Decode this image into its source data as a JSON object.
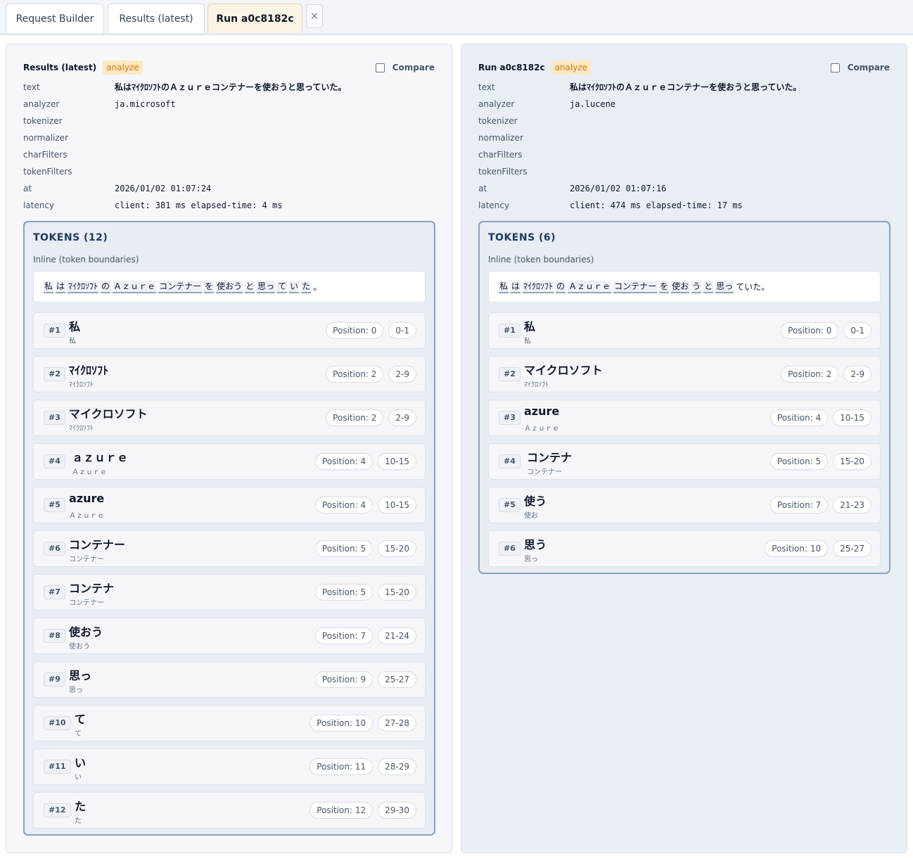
{
  "tabs": [
    {
      "label": "Request Builder"
    },
    {
      "label": "Results (latest)"
    },
    {
      "label": "Run a0c8182c"
    }
  ],
  "tab_close_label": "×",
  "panels": [
    {
      "title": "Results (latest)",
      "badge": "analyze",
      "compare_label": "Compare",
      "meta": [
        {
          "key": "text",
          "value": "私はﾏｲｸﾛｿﾌﾄのＡｚｕｒｅコンテナーを使おうと思っていた。"
        },
        {
          "key": "analyzer",
          "value": "ja.microsoft"
        },
        {
          "key": "tokenizer",
          "value": ""
        },
        {
          "key": "normalizer",
          "value": ""
        },
        {
          "key": "charFilters",
          "value": ""
        },
        {
          "key": "tokenFilters",
          "value": ""
        },
        {
          "key": "at",
          "value": "2026/01/02 01:07:24"
        },
        {
          "key": "latency",
          "value": "client: 381 ms  elapsed-time: 4 ms"
        }
      ],
      "tokens_title": "TOKENS (12)",
      "inline_label": "Inline (token boundaries)",
      "inline_segments": [
        "私",
        "は",
        "ﾏｲｸﾛｿﾌﾄ",
        "の",
        "Ａｚｕｒｅ",
        "コンテナー",
        "を",
        "使おう",
        "と",
        "思っ",
        "て",
        "い",
        "た"
      ],
      "inline_rest": "。",
      "tokens": [
        {
          "index": "#1",
          "term": "私",
          "source": "私",
          "position": "Position: 0",
          "offsets": "0-1"
        },
        {
          "index": "#2",
          "term": "ﾏｲｸﾛｿﾌﾄ",
          "source": "ﾏｲｸﾛｿﾌﾄ",
          "position": "Position: 2",
          "offsets": "2-9"
        },
        {
          "index": "#3",
          "term": "マイクロソフト",
          "source": "ﾏｲｸﾛｿﾌﾄ",
          "position": "Position: 2",
          "offsets": "2-9"
        },
        {
          "index": "#4",
          "term": "ａｚｕｒｅ",
          "source": "Ａｚｕｒｅ",
          "position": "Position: 4",
          "offsets": "10-15"
        },
        {
          "index": "#5",
          "term": "azure",
          "source": "Ａｚｕｒｅ",
          "position": "Position: 4",
          "offsets": "10-15"
        },
        {
          "index": "#6",
          "term": "コンテナー",
          "source": "コンテナー",
          "position": "Position: 5",
          "offsets": "15-20"
        },
        {
          "index": "#7",
          "term": "コンテナ",
          "source": "コンテナー",
          "position": "Position: 5",
          "offsets": "15-20"
        },
        {
          "index": "#8",
          "term": "使おう",
          "source": "使おう",
          "position": "Position: 7",
          "offsets": "21-24"
        },
        {
          "index": "#9",
          "term": "思っ",
          "source": "思っ",
          "position": "Position: 9",
          "offsets": "25-27"
        },
        {
          "index": "#10",
          "term": "て",
          "source": "て",
          "position": "Position: 10",
          "offsets": "27-28"
        },
        {
          "index": "#11",
          "term": "い",
          "source": "い",
          "position": "Position: 11",
          "offsets": "28-29"
        },
        {
          "index": "#12",
          "term": "た",
          "source": "た",
          "position": "Position: 12",
          "offsets": "29-30"
        }
      ]
    },
    {
      "title": "Run a0c8182c",
      "badge": "analyze",
      "compare_label": "Compare",
      "meta": [
        {
          "key": "text",
          "value": "私はﾏｲｸﾛｿﾌﾄのＡｚｕｒｅコンテナーを使おうと思っていた。"
        },
        {
          "key": "analyzer",
          "value": "ja.lucene"
        },
        {
          "key": "tokenizer",
          "value": ""
        },
        {
          "key": "normalizer",
          "value": ""
        },
        {
          "key": "charFilters",
          "value": ""
        },
        {
          "key": "tokenFilters",
          "value": ""
        },
        {
          "key": "at",
          "value": "2026/01/02 01:07:16"
        },
        {
          "key": "latency",
          "value": "client: 474 ms  elapsed-time: 17 ms"
        }
      ],
      "tokens_title": "TOKENS (6)",
      "inline_label": "Inline (token boundaries)",
      "inline_segments": [
        "私",
        "は",
        "ﾏｲｸﾛｿﾌﾄ",
        "の",
        "Ａｚｕｒｅ",
        "コンテナー",
        "を",
        "使お",
        "う",
        "と",
        "思っ"
      ],
      "inline_rest": "ていた。",
      "tokens": [
        {
          "index": "#1",
          "term": "私",
          "source": "私",
          "position": "Position: 0",
          "offsets": "0-1"
        },
        {
          "index": "#2",
          "term": "マイクロソフト",
          "source": "ﾏｲｸﾛｿﾌﾄ",
          "position": "Position: 2",
          "offsets": "2-9"
        },
        {
          "index": "#3",
          "term": "azure",
          "source": "Ａｚｕｒｅ",
          "position": "Position: 4",
          "offsets": "10-15"
        },
        {
          "index": "#4",
          "term": "コンテナ",
          "source": "コンテナー",
          "position": "Position: 5",
          "offsets": "15-20"
        },
        {
          "index": "#5",
          "term": "使う",
          "source": "使お",
          "position": "Position: 7",
          "offsets": "21-23"
        },
        {
          "index": "#6",
          "term": "思う",
          "source": "思っ",
          "position": "Position: 10",
          "offsets": "25-27"
        }
      ]
    }
  ]
}
